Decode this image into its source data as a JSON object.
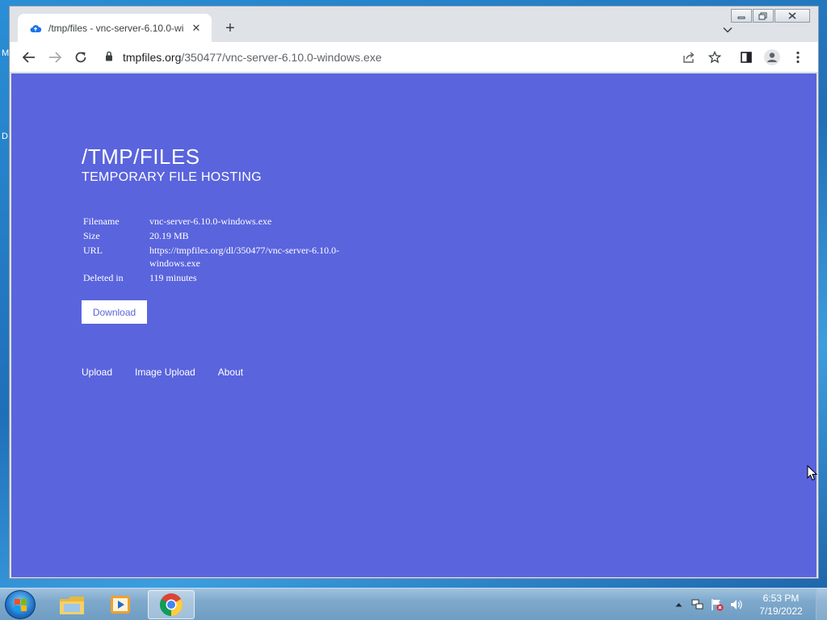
{
  "desktop": {
    "left_letters": [
      "M",
      "D"
    ]
  },
  "browser": {
    "tab": {
      "title": "/tmp/files - vnc-server-6.10.0-wi",
      "favicon": "cloud-upload-icon"
    },
    "url": {
      "host": "tmpfiles.org",
      "path": "/350477/vnc-server-6.10.0-windows.exe"
    },
    "window_buttons": {
      "minimize": "minimize",
      "maximize": "maximize",
      "close": "close"
    }
  },
  "page": {
    "title": "/TMP/FILES",
    "subtitle": "TEMPORARY FILE HOSTING",
    "file_info": [
      {
        "label": "Filename",
        "value": "vnc-server-6.10.0-windows.exe"
      },
      {
        "label": "Size",
        "value": "20.19 MB"
      },
      {
        "label": "URL",
        "value": "https://tmpfiles.org/dl/350477/vnc-server-6.10.0-windows.exe"
      },
      {
        "label": "Deleted in",
        "value": "119 minutes"
      }
    ],
    "download_label": "Download",
    "footer_links": [
      "Upload",
      "Image Upload",
      "About"
    ],
    "colors": {
      "background": "#5a64dd",
      "text": "#ffffff"
    }
  },
  "taskbar": {
    "items": [
      "windows-explorer",
      "media-player",
      "chrome"
    ],
    "clock": {
      "time": "6:53 PM",
      "date": "7/19/2022"
    }
  }
}
